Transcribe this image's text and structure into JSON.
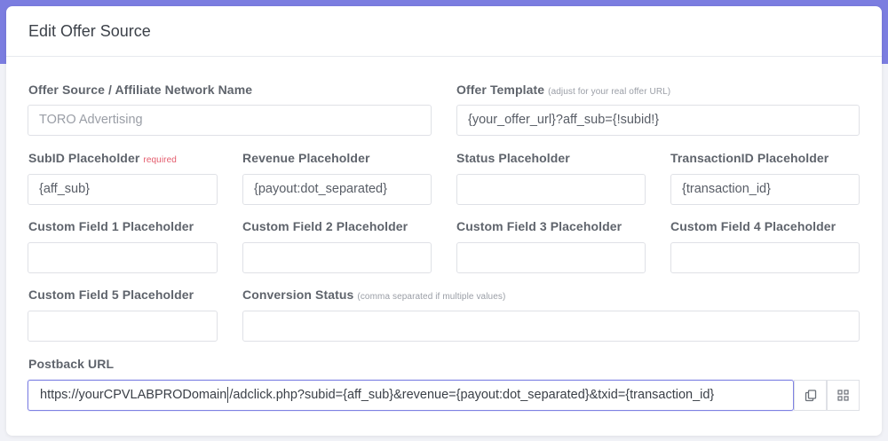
{
  "modal": {
    "title": "Edit Offer Source"
  },
  "fields": {
    "name": {
      "label": "Offer Source / Affiliate Network Name",
      "placeholder": "TORO Advertising"
    },
    "template": {
      "label": "Offer Template",
      "hint": "(adjust for your real offer URL)",
      "value": "{your_offer_url}?aff_sub={!subid!}"
    },
    "subid": {
      "label": "SubID Placeholder",
      "required": "required",
      "value": "{aff_sub}"
    },
    "revenue": {
      "label": "Revenue Placeholder",
      "value": "{payout:dot_separated}"
    },
    "status": {
      "label": "Status Placeholder",
      "value": ""
    },
    "txid": {
      "label": "TransactionID Placeholder",
      "value": "{transaction_id}"
    },
    "custom1": {
      "label": "Custom Field 1 Placeholder",
      "value": ""
    },
    "custom2": {
      "label": "Custom Field 2 Placeholder",
      "value": ""
    },
    "custom3": {
      "label": "Custom Field 3 Placeholder",
      "value": ""
    },
    "custom4": {
      "label": "Custom Field 4 Placeholder",
      "value": ""
    },
    "custom5": {
      "label": "Custom Field 5 Placeholder",
      "value": ""
    },
    "conversion": {
      "label": "Conversion Status",
      "hint": "(comma separated if multiple values)",
      "value": ""
    },
    "postback": {
      "label": "Postback URL",
      "value_before_caret": "https://yourCPVLABPRODomain",
      "value_after_caret": "/adclick.php?subid={aff_sub}&revenue={payout:dot_separated}&txid={transaction_id}",
      "copy_icon": "copy-icon",
      "qr_icon": "grid-icon"
    }
  },
  "colors": {
    "accent": "#7b7de0",
    "required": "#e45b6c",
    "background": "#f1f2f7"
  }
}
